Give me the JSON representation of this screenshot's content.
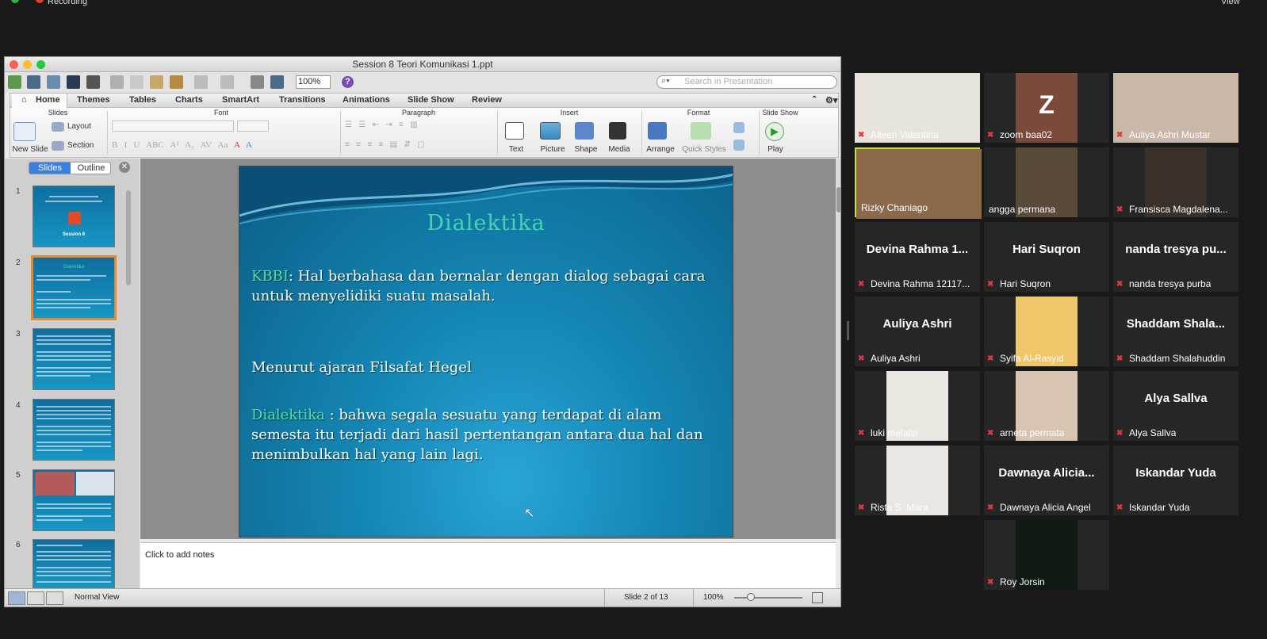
{
  "zoom_bar": {
    "recording_label": "Recording",
    "view_label": "View"
  },
  "window": {
    "title": "Session 8 Teori Komunikasi 1.ppt"
  },
  "toolbar": {
    "zoom_value": "100%",
    "search_placeholder": "Search in Presentation"
  },
  "ribbon_tabs": [
    "Home",
    "Themes",
    "Tables",
    "Charts",
    "SmartArt",
    "Transitions",
    "Animations",
    "Slide Show",
    "Review"
  ],
  "ribbon": {
    "groups": {
      "slides": "Slides",
      "font": "Font",
      "paragraph": "Paragraph",
      "insert": "Insert",
      "format": "Format",
      "slide_show": "Slide Show"
    },
    "new_slide": "New Slide",
    "layout": "Layout",
    "section": "Section",
    "insert_buttons": [
      "Text",
      "Picture",
      "Shape",
      "Media"
    ],
    "format_buttons": [
      "Arrange",
      "Quick Styles"
    ],
    "play": "Play"
  },
  "left_pane": {
    "tab_slides": "Slides",
    "tab_outline": "Outline",
    "thumb_numbers": [
      "1",
      "2",
      "3",
      "4",
      "5",
      "6"
    ],
    "thumb1_title": "Session 8",
    "thumb2_title": "Dialektika"
  },
  "slide": {
    "title": "Dialektika",
    "para1_highlight": "KBBI",
    "para1_text": ": Hal berbahasa dan bernalar dengan dialog sebagai cara untuk menyelidiki suatu masalah.",
    "para2_text": "Menurut ajaran Filsafat Hegel",
    "para3_highlight": "Dialektika",
    "para3_text": " : bahwa segala sesuatu yang terdapat di alam semesta itu terjadi dari hasil pertentangan antara dua hal dan menimbulkan hal yang lain lagi."
  },
  "notes": {
    "placeholder": "Click to add notes"
  },
  "status": {
    "view_name": "Normal View",
    "slide_indicator": "Slide 2 of 13",
    "zoom": "100%"
  },
  "participants": [
    {
      "name": "Aileen Valentina",
      "big": ""
    },
    {
      "name": "zoom baa02",
      "big": "Z"
    },
    {
      "name": "Auliya Ashri Mustar",
      "big": ""
    },
    {
      "name": "Rizky Chaniago",
      "big": ""
    },
    {
      "name": "angga permana",
      "big": ""
    },
    {
      "name": "Fransisca Magdalena...",
      "big": ""
    },
    {
      "name": "Devina Rahma 12117...",
      "big": "Devina Rahma 1..."
    },
    {
      "name": "Hari Suqron",
      "big": "Hari Suqron"
    },
    {
      "name": "nanda tresya purba",
      "big": "nanda tresya pu..."
    },
    {
      "name": "Auliya Ashri",
      "big": "Auliya Ashri"
    },
    {
      "name": "Syifa Al-Rasyid",
      "big": ""
    },
    {
      "name": "Shaddam Shalahuddin",
      "big": "Shaddam  Shala..."
    },
    {
      "name": "luki melatip",
      "big": ""
    },
    {
      "name": "arneta permata",
      "big": ""
    },
    {
      "name": "Alya Sallva",
      "big": "Alya Sallva"
    },
    {
      "name": "Rista S. Mara",
      "big": ""
    },
    {
      "name": "Dawnaya Alicia Angel",
      "big": "Dawnaya  Alicia..."
    },
    {
      "name": "Iskandar Yuda",
      "big": "Iskandar Yuda"
    },
    {
      "name": "Roy Jorsin",
      "big": ""
    }
  ]
}
